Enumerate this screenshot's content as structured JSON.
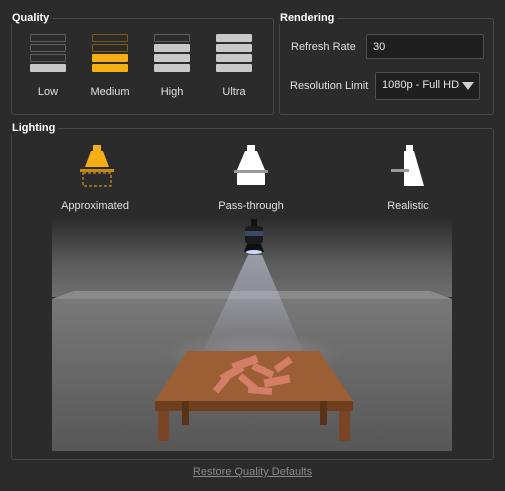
{
  "quality": {
    "title": "Quality",
    "selected": "Medium",
    "options": [
      {
        "label": "Low",
        "level": 1
      },
      {
        "label": "Medium",
        "level": 2
      },
      {
        "label": "High",
        "level": 3
      },
      {
        "label": "Ultra",
        "level": 4
      }
    ]
  },
  "rendering": {
    "title": "Rendering",
    "refresh_rate_label": "Refresh Rate",
    "refresh_rate_value": "30",
    "resolution_label": "Resolution Limit",
    "resolution_value": "1080p - Full HD"
  },
  "lighting": {
    "title": "Lighting",
    "options": [
      {
        "label": "Approximated",
        "selected": true
      },
      {
        "label": "Pass-through",
        "selected": false
      },
      {
        "label": "Realistic",
        "selected": false
      }
    ]
  },
  "restore_label": "Restore Quality Defaults",
  "colors": {
    "accent": "#f5ae14",
    "panel_bg": "#2b2b2b",
    "border": "#474747"
  }
}
